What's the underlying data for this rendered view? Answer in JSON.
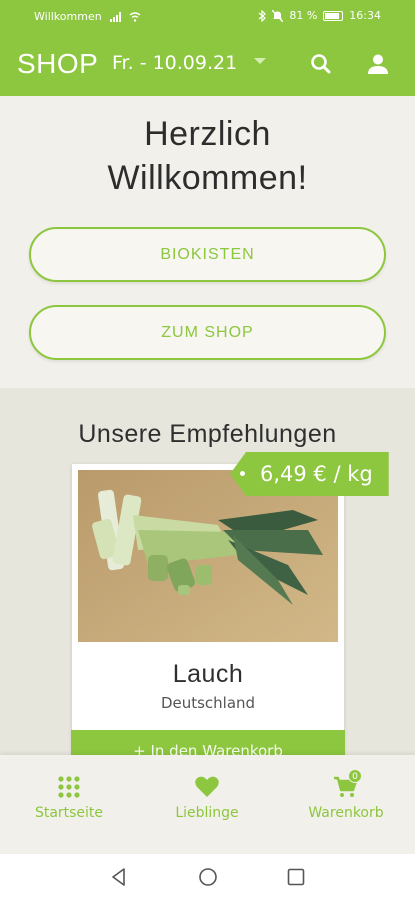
{
  "status_bar": {
    "carrier": "Willkommen",
    "battery": "81 %",
    "time": "16:34"
  },
  "header": {
    "title": "SHOP",
    "date_select": "Fr. - 10.09.21"
  },
  "welcome": {
    "line1": "Herzlich",
    "line2": "Willkommen!"
  },
  "buttons": {
    "biokisten": "BIOKISTEN",
    "zum_shop": "ZUM SHOP"
  },
  "recommendations": {
    "title": "Unsere Empfehlungen",
    "product": {
      "name": "Lauch",
      "origin": "Deutschland",
      "price": "6,49 € / kg",
      "add_to_cart": "+ In den Warenkorb"
    }
  },
  "bottom_nav": {
    "items": [
      {
        "label": "Startseite",
        "icon": "grid-icon"
      },
      {
        "label": "Lieblinge",
        "icon": "heart-icon"
      },
      {
        "label": "Warenkorb",
        "icon": "cart-icon",
        "badge": "0"
      }
    ]
  },
  "colors": {
    "brand": "#8dc63f",
    "background": "#f2f0ea",
    "section": "#e7e6dd"
  }
}
